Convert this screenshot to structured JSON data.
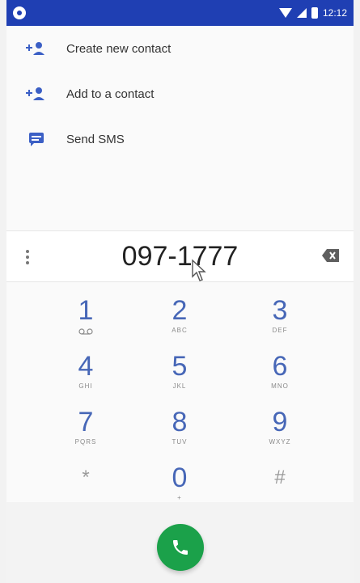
{
  "status_bar": {
    "time": "12:12"
  },
  "suggestions": [
    {
      "label": "Create new contact",
      "icon": "add-person-icon"
    },
    {
      "label": "Add to a contact",
      "icon": "add-person-icon"
    },
    {
      "label": "Send SMS",
      "icon": "message-icon"
    }
  ],
  "display": {
    "number": "097-1777"
  },
  "keypad": {
    "keys": [
      {
        "digit": "1",
        "letters": ""
      },
      {
        "digit": "2",
        "letters": "ABC"
      },
      {
        "digit": "3",
        "letters": "DEF"
      },
      {
        "digit": "4",
        "letters": "GHI"
      },
      {
        "digit": "5",
        "letters": "JKL"
      },
      {
        "digit": "6",
        "letters": "MNO"
      },
      {
        "digit": "7",
        "letters": "PQRS"
      },
      {
        "digit": "8",
        "letters": "TUV"
      },
      {
        "digit": "9",
        "letters": "WXYZ"
      },
      {
        "digit": "*",
        "letters": ""
      },
      {
        "digit": "0",
        "letters": "+"
      },
      {
        "digit": "#",
        "letters": ""
      }
    ]
  },
  "colors": {
    "status_bar": "#1f3fb3",
    "accent": "#4767b7",
    "call": "#1ba14a"
  }
}
